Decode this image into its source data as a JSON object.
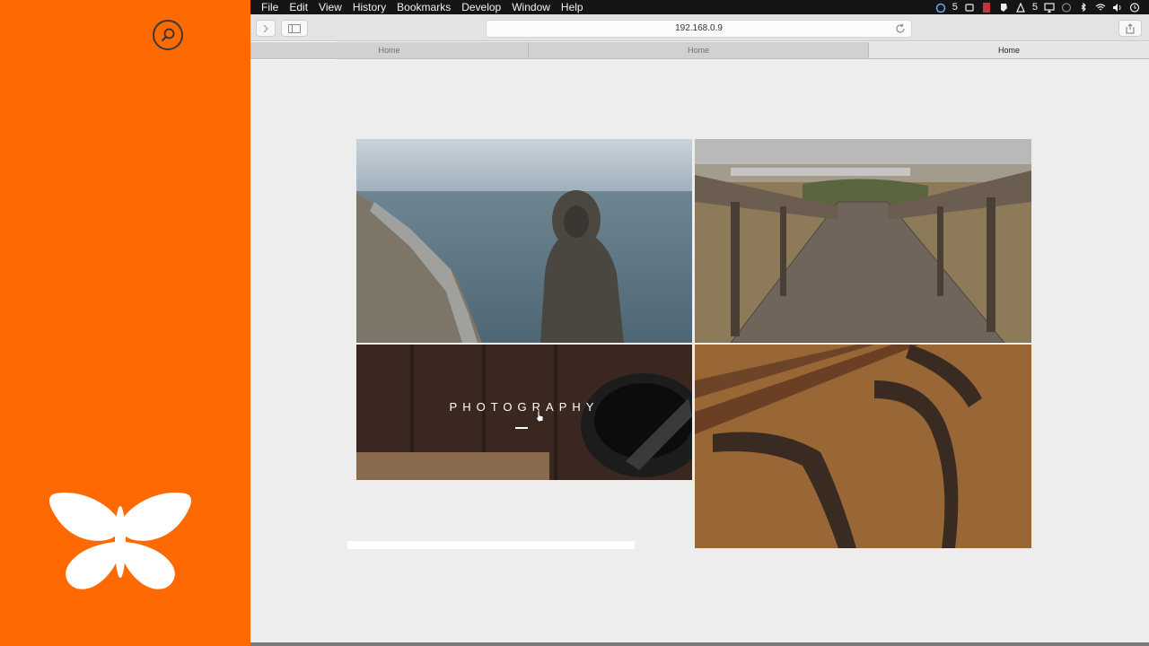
{
  "menubar": {
    "menus": [
      "File",
      "Edit",
      "View",
      "History",
      "Bookmarks",
      "Develop",
      "Window",
      "Help"
    ],
    "tray_badge_1": "5",
    "tray_badge_2": "5",
    "icons": [
      "creative-cloud-icon",
      "sync-icon",
      "battery-icon",
      "evernote-icon",
      "adobe-icon",
      "airplay-icon",
      "time-machine-icon",
      "bluetooth-icon",
      "wifi-icon",
      "volume-icon",
      "clock-icon"
    ]
  },
  "toolbar": {
    "address": "192.168.0.9"
  },
  "tabs": [
    {
      "label": "Home",
      "active": false
    },
    {
      "label": "Home",
      "active": false
    },
    {
      "label": "Home",
      "active": true
    }
  ],
  "gallery": {
    "photography_label": "PHOTOGRAPHY"
  },
  "colors": {
    "brand_orange": "#fe6a01",
    "page_background": "#ededed"
  }
}
